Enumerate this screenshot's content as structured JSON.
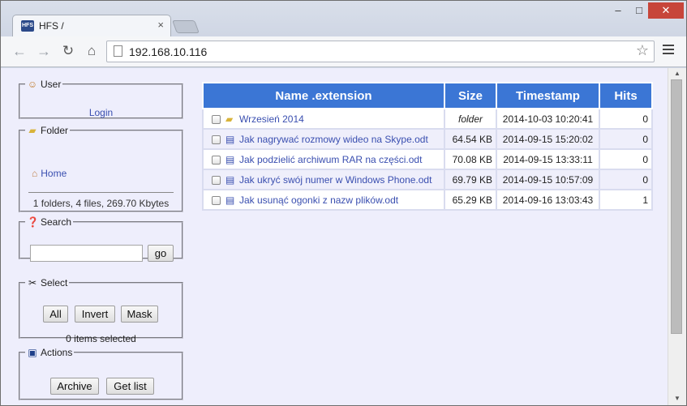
{
  "tab": {
    "title": "HFS /",
    "favicon_text": "HFS"
  },
  "address_bar": {
    "url": "192.168.10.116"
  },
  "user_panel": {
    "legend": "User",
    "login_label": "Login"
  },
  "folder_panel": {
    "legend": "Folder",
    "home_label": "Home",
    "stats": "1 folders, 4 files, 269.70 Kbytes"
  },
  "search_panel": {
    "legend": "Search",
    "input_value": "",
    "go_label": "go"
  },
  "select_panel": {
    "legend": "Select",
    "all_label": "All",
    "invert_label": "Invert",
    "mask_label": "Mask",
    "selected_status": "0 items selected"
  },
  "actions_panel": {
    "legend": "Actions",
    "archive_label": "Archive",
    "getlist_label": "Get list"
  },
  "table": {
    "headers": {
      "name": "Name .extension",
      "size": "Size",
      "timestamp": "Timestamp",
      "hits": "Hits"
    },
    "rows": [
      {
        "type": "folder",
        "name": "Wrzesień 2014",
        "size": "folder",
        "timestamp": "2014-10-03 10:20:41",
        "hits": "0"
      },
      {
        "type": "file",
        "name": "Jak nagrywać rozmowy wideo na Skype.odt",
        "size": "64.54 KB",
        "timestamp": "2014-09-15 15:20:02",
        "hits": "0"
      },
      {
        "type": "file",
        "name": "Jak podzielić archiwum RAR na części.odt",
        "size": "70.08 KB",
        "timestamp": "2014-09-15 13:33:11",
        "hits": "0"
      },
      {
        "type": "file",
        "name": "Jak ukryć swój numer w Windows Phone.odt",
        "size": "69.79 KB",
        "timestamp": "2014-09-15 10:57:09",
        "hits": "0"
      },
      {
        "type": "file",
        "name": "Jak usunąć ogonki z nazw plików.odt",
        "size": "65.29 KB",
        "timestamp": "2014-09-16 13:03:43",
        "hits": "1"
      }
    ]
  },
  "colors": {
    "header_bg": "#3b76d5",
    "page_bg": "#eeeefc",
    "link": "#3a4fb0"
  }
}
